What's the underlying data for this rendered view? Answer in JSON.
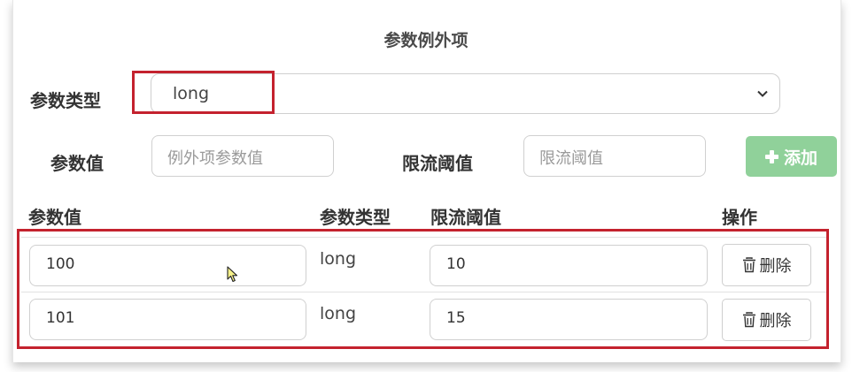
{
  "title": "参数例外项",
  "param_type": {
    "label": "参数类型",
    "selected": "long"
  },
  "param_value": {
    "label": "参数值",
    "placeholder": "例外项参数值"
  },
  "threshold": {
    "label": "限流阈值",
    "placeholder": "限流阈值"
  },
  "add_button": {
    "label": "添加",
    "icon": "plus-icon"
  },
  "table": {
    "headers": [
      "参数值",
      "参数类型",
      "限流阈值",
      "操作"
    ],
    "rows": [
      {
        "value": "100",
        "type": "long",
        "threshold": "10",
        "action": "删除"
      },
      {
        "value": "101",
        "type": "long",
        "threshold": "15",
        "action": "删除"
      }
    ]
  },
  "colors": {
    "highlight": "#c4222e",
    "add_button": "#90d19a"
  }
}
